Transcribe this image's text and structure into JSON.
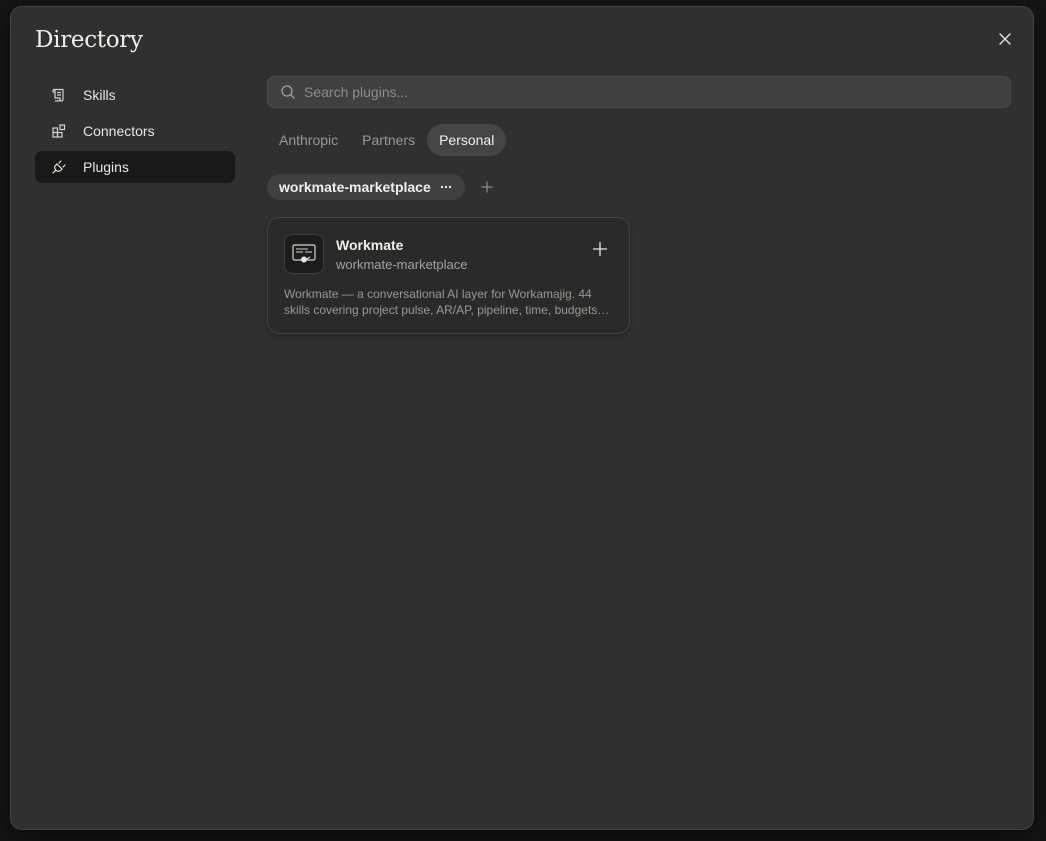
{
  "title": "Directory",
  "sidebar": {
    "items": [
      {
        "label": "Skills",
        "icon": "scroll-icon",
        "active": false
      },
      {
        "label": "Connectors",
        "icon": "blocks-icon",
        "active": false
      },
      {
        "label": "Plugins",
        "icon": "plug-icon",
        "active": true
      }
    ]
  },
  "search": {
    "placeholder": "Search plugins..."
  },
  "tabs": [
    {
      "label": "Anthropic",
      "active": false
    },
    {
      "label": "Partners",
      "active": false
    },
    {
      "label": "Personal",
      "active": true
    }
  ],
  "marketplace_chip": {
    "label": "workmate-marketplace"
  },
  "plugins": [
    {
      "name": "Workmate",
      "source": "workmate-marketplace",
      "description": "Workmate — a conversational AI layer for Workamajig. 44 skills covering project pulse, AR/AP, pipeline, time, budgets and more."
    }
  ],
  "colors": {
    "modal_bg": "#303030",
    "active_item_bg": "#191919",
    "active_tab_bg": "#454545"
  }
}
